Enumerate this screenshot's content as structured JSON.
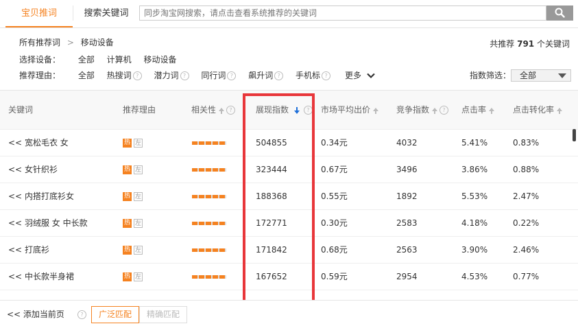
{
  "tabs": {
    "active": "宝贝推词",
    "keywords": "搜索关键词"
  },
  "search": {
    "placeholder": "同步淘宝网搜索，请点击查看系统推荐的关键词",
    "button_icon": "search-icon"
  },
  "breadcrumb": {
    "root": "所有推荐词",
    "sep": ">",
    "current": "移动设备"
  },
  "total": {
    "prefix": "共推荐",
    "count": "791",
    "suffix": "个关键词"
  },
  "device": {
    "label": "选择设备：",
    "options": [
      "全部",
      "计算机",
      "移动设备"
    ]
  },
  "reason": {
    "label": "推荐理由：",
    "options": [
      "全部",
      "热搜词",
      "潜力词",
      "同行词",
      "飙升词",
      "手机标"
    ],
    "more": "更多"
  },
  "index_filter": {
    "label": "指数筛选：",
    "selected": "全部"
  },
  "columns": [
    "关键词",
    "推荐理由",
    "相关性",
    "展现指数",
    "市场平均出价",
    "竞争指数",
    "点击率",
    "点击转化率"
  ],
  "rows": [
    {
      "keyword": "宽松毛衣 女",
      "hot": "热",
      "left": "左",
      "relevance": 5,
      "impressions": "504855",
      "avg_bid": "0.34元",
      "competition": "4032",
      "ctr": "5.41%",
      "cvr": "0.83%"
    },
    {
      "keyword": "女针织衫",
      "hot": "热",
      "left": "左",
      "relevance": 5,
      "impressions": "323444",
      "avg_bid": "0.67元",
      "competition": "3496",
      "ctr": "3.86%",
      "cvr": "0.88%"
    },
    {
      "keyword": "内搭打底衫女",
      "hot": "热",
      "left": "左",
      "relevance": 5,
      "impressions": "188368",
      "avg_bid": "0.55元",
      "competition": "1892",
      "ctr": "5.53%",
      "cvr": "2.47%"
    },
    {
      "keyword": "羽绒服 女 中长款",
      "hot": "热",
      "left": "左",
      "relevance": 5,
      "impressions": "172771",
      "avg_bid": "0.30元",
      "competition": "2583",
      "ctr": "4.18%",
      "cvr": "0.22%"
    },
    {
      "keyword": "打底衫",
      "hot": "热",
      "left": "左",
      "relevance": 5,
      "impressions": "171842",
      "avg_bid": "0.68元",
      "competition": "2563",
      "ctr": "3.90%",
      "cvr": "2.46%"
    },
    {
      "keyword": "中长款半身裙",
      "hot": "热",
      "left": "左",
      "relevance": 5,
      "impressions": "167652",
      "avg_bid": "0.59元",
      "competition": "2954",
      "ctr": "4.53%",
      "cvr": "0.77%"
    }
  ],
  "row_prefix": "<<",
  "footer": {
    "add": "<< 添加当前页",
    "broad": "广泛匹配",
    "exact": "精确匹配"
  },
  "colors": {
    "accent": "#f58220",
    "highlight": "#e8363a",
    "sort_active": "#1e6fd9"
  }
}
